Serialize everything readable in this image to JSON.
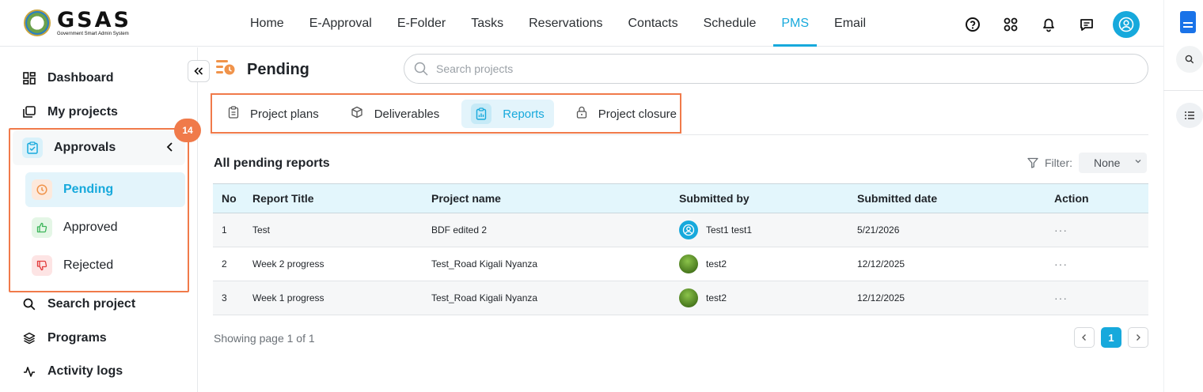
{
  "logo": {
    "brand": "GSAS",
    "tagline": "Government Smart Admin System"
  },
  "nav": {
    "items": [
      {
        "label": "Home"
      },
      {
        "label": "E-Approval"
      },
      {
        "label": "E-Folder"
      },
      {
        "label": "Tasks"
      },
      {
        "label": "Reservations"
      },
      {
        "label": "Contacts"
      },
      {
        "label": "Schedule"
      },
      {
        "label": "PMS",
        "active": true
      },
      {
        "label": "Email"
      }
    ]
  },
  "sidebar": {
    "dashboard": "Dashboard",
    "my_projects": "My projects",
    "approvals": {
      "label": "Approvals",
      "badge": "14",
      "pending": "Pending",
      "approved": "Approved",
      "rejected": "Rejected"
    },
    "search_project": "Search project",
    "programs": "Programs",
    "activity_logs": "Activity logs"
  },
  "page": {
    "title": "Pending",
    "search_placeholder": "Search projects",
    "tabs": [
      {
        "label": "Project plans"
      },
      {
        "label": "Deliverables"
      },
      {
        "label": "Reports",
        "active": true
      },
      {
        "label": "Project closure"
      }
    ],
    "section_title": "All pending reports",
    "filter_label": "Filter:",
    "filter_value": "None"
  },
  "table": {
    "columns": [
      "No",
      "Report Title",
      "Project name",
      "Submitted by",
      "Submitted date",
      "Action"
    ],
    "rows": [
      {
        "no": "1",
        "title": "Test",
        "project": "BDF edited 2",
        "submitted_by": "Test1 test1",
        "date": "5/21/2026",
        "action": "···"
      },
      {
        "no": "2",
        "title": "Week 2 progress",
        "project": "Test_Road Kigali Nyanza",
        "submitted_by": "test2",
        "date": "12/12/2025",
        "action": "···"
      },
      {
        "no": "3",
        "title": "Week 1 progress",
        "project": "Test_Road Kigali Nyanza",
        "submitted_by": "test2",
        "date": "12/12/2025",
        "action": "···"
      }
    ]
  },
  "pagination": {
    "summary": "Showing page 1 of 1",
    "current": "1"
  },
  "colors": {
    "accent": "#17a9dc",
    "highlight": "#f07a4a"
  }
}
